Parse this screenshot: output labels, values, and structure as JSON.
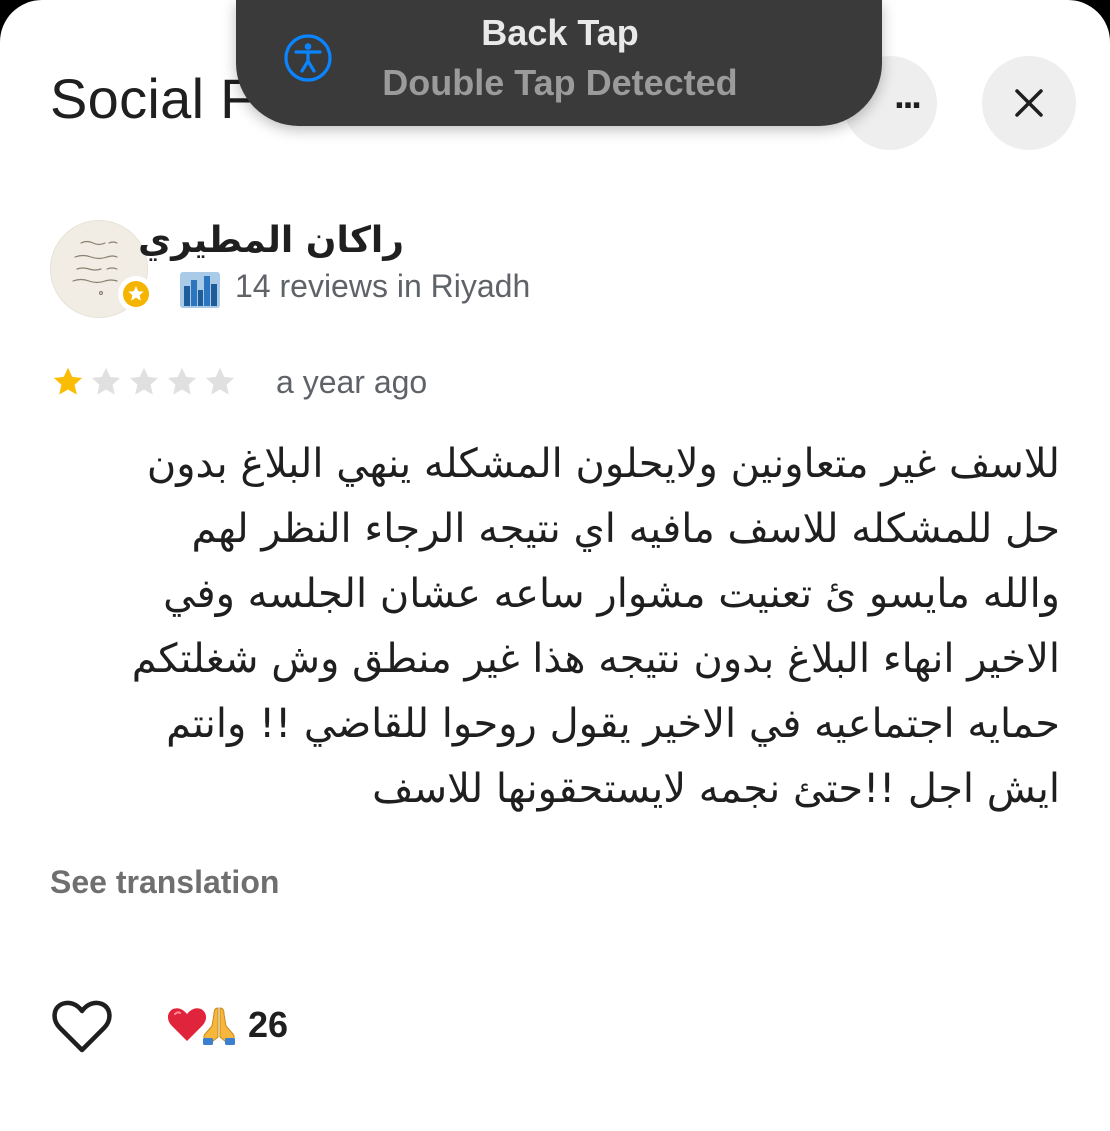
{
  "header": {
    "title": "Social F",
    "more_label": "...",
    "close_icon": "close-icon"
  },
  "banner": {
    "icon": "accessibility-icon",
    "title": "Back Tap",
    "subtitle": "Double Tap Detected",
    "accent": "#0a84ff"
  },
  "review": {
    "reviewer_name": "راكان المطيري",
    "reviewer_meta": "14 reviews in Riyadh",
    "rating": 1,
    "max_rating": 5,
    "star_color": "#fbbc04",
    "time_ago": "a year ago",
    "body_lines": [
      "للاسف غير متعاونين ولايحلون المشكله ينهي البلاغ بدون",
      "حل للمشكله للاسف مافيه اي نتيجه الرجاء النظر لهم",
      "والله مايسو ئ  تعنيت مشوار ساعه عشان الجلسه وفي",
      "الاخير انهاء البلاغ بدون نتيجه هذا غير منطق وش شغلتكم",
      "حمايه اجتماعيه في الاخير يقول روحوا للقاضي !! وانتم",
      "ايش اجل !!حتئ نجمه لايستحقونها للاسف"
    ],
    "see_translation": "See translation",
    "reaction_count": "26"
  }
}
